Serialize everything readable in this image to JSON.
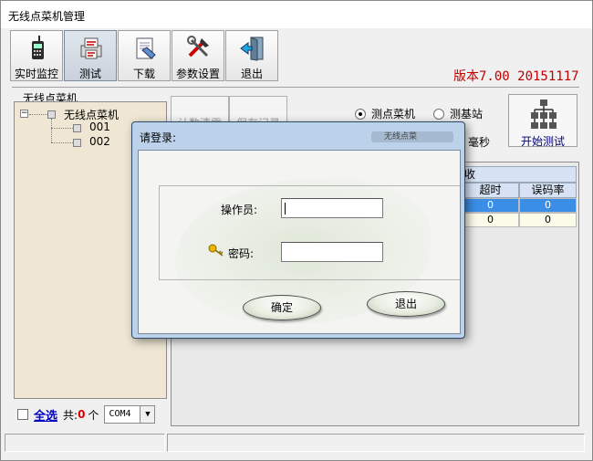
{
  "window": {
    "title": "无线点菜机管理"
  },
  "toolbar": {
    "buttons": [
      {
        "label": "实时监控",
        "icon": "handheld-device-icon"
      },
      {
        "label": "测试",
        "icon": "printer-test-icon"
      },
      {
        "label": "下载",
        "icon": "download-document-icon"
      },
      {
        "label": "参数设置",
        "icon": "tools-icon"
      },
      {
        "label": "退出",
        "icon": "exit-door-icon"
      }
    ]
  },
  "version": "版本7.00 20151117",
  "tree": {
    "caption": "无线点菜机",
    "root": "无线点菜机",
    "children": [
      "001",
      "002"
    ]
  },
  "selection": {
    "select_all": "全选",
    "count_prefix": "共:",
    "count": "0",
    "count_suffix": "个",
    "port": "COM4"
  },
  "test_panel": {
    "btn1": "计数清零",
    "btn2": "保存记录",
    "radio1": "测点菜机",
    "radio2": "测基站",
    "ms": "毫秒",
    "start": "开始测试"
  },
  "grid": {
    "header": "收",
    "columns": [
      "超时",
      "误码率"
    ],
    "rows": [
      [
        "0",
        "0"
      ],
      [
        "0",
        "0"
      ]
    ]
  },
  "dialog": {
    "title": "请登录:",
    "blurred": "无线点菜",
    "operator_label": "操作员:",
    "operator_value": "",
    "password_label": "密码:",
    "password_value": "",
    "ok": "确定",
    "cancel": "退出"
  }
}
